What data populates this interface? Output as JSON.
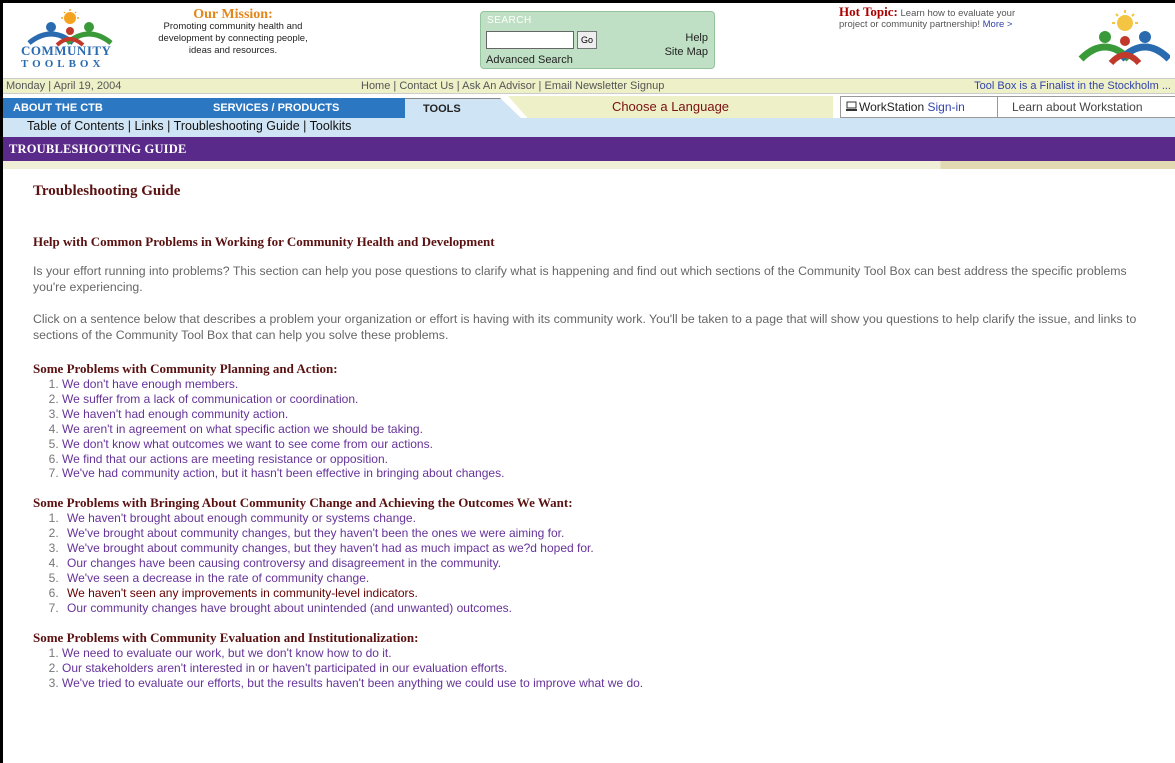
{
  "header": {
    "logo_line1": "COMMUNITY",
    "logo_line2": "TOOLBOX",
    "mission_title": "Our Mission:",
    "mission_text_lines": [
      "Promoting community health and",
      "development by connecting people,",
      "ideas and resources."
    ],
    "search_label": "SEARCH",
    "search_value": "",
    "go_label": "Go",
    "help_label": "Help",
    "sitemap_label": "Site Map",
    "advanced_search_label": "Advanced Search",
    "hot_topic_title": "Hot Topic:",
    "hot_topic_text": "Learn how to evaluate your project or community partnership!",
    "hot_topic_more": "More >"
  },
  "dateline": {
    "date": "Monday | April 19, 2004",
    "nav": [
      "Home",
      "Contact Us",
      "Ask An Advisor",
      "Email Newsletter Signup"
    ],
    "ticker": "Tool Box is a Finalist in the Stockholm ..."
  },
  "tabs": {
    "about": "ABOUT THE CTB",
    "services": "SERVICES / PRODUCTS",
    "tools": "TOOLS",
    "language": "Choose a Language",
    "workstation_prefix": "WorkStation",
    "workstation_signin": "Sign-in",
    "learn_workstation": "Learn about Workstation"
  },
  "subnav": [
    "Table of Contents",
    "Links",
    "Troubleshooting Guide",
    "Toolkits"
  ],
  "section_bar": "TROUBLESHOOTING GUIDE",
  "content": {
    "title": "Troubleshooting Guide",
    "heading": "Help with Common Problems in Working for Community Health and Development",
    "para1": "Is your effort running into problems? This section can help you pose questions to clarify what is happening and find out which sections of the Community Tool Box can best address the specific problems you're experiencing.",
    "para2": "Click on a sentence below that describes a problem your organization or effort is having with its community work. You'll be taken to a page that will show you questions to help clarify the issue, and links to sections of the Community Tool Box that can help you solve these problems.",
    "groups": [
      {
        "title": "Some Problems with Community Planning and Action:",
        "items": [
          "We don't have enough members.",
          "We suffer from a lack of communication or coordination.",
          "We haven't had enough community action.",
          "We aren't in agreement on what specific action we should be taking.",
          "We don't know what outcomes we want to see come from our actions.",
          "We find that our actions are meeting resistance or opposition.",
          "We've had community action, but it hasn't been effective in bringing about changes."
        ]
      },
      {
        "title": "Some Problems with Bringing About Community Change and Achieving the Outcomes We Want:",
        "items": [
          "We haven't brought about enough community or systems change.",
          "We've brought about community changes, but they haven't been the ones we were aiming for.",
          "We've brought about community changes, but they haven't had as much impact as we?d hoped for.",
          "Our changes have been causing controversy and disagreement in the community.",
          "We've seen a decrease in the rate of community change.",
          "We haven't seen any improvements in community-level indicators.",
          "Our community changes have brought about unintended (and unwanted) outcomes."
        ]
      },
      {
        "title": "Some Problems with Community Evaluation and Institutionalization:",
        "items": [
          "We need to evaluate our work, but we don't know how to do it.",
          "Our stakeholders aren't interested in or haven't participated in our evaluation efforts.",
          "We've tried to evaluate our efforts, but the results haven't been anything we could use to improve what we do."
        ]
      }
    ]
  }
}
